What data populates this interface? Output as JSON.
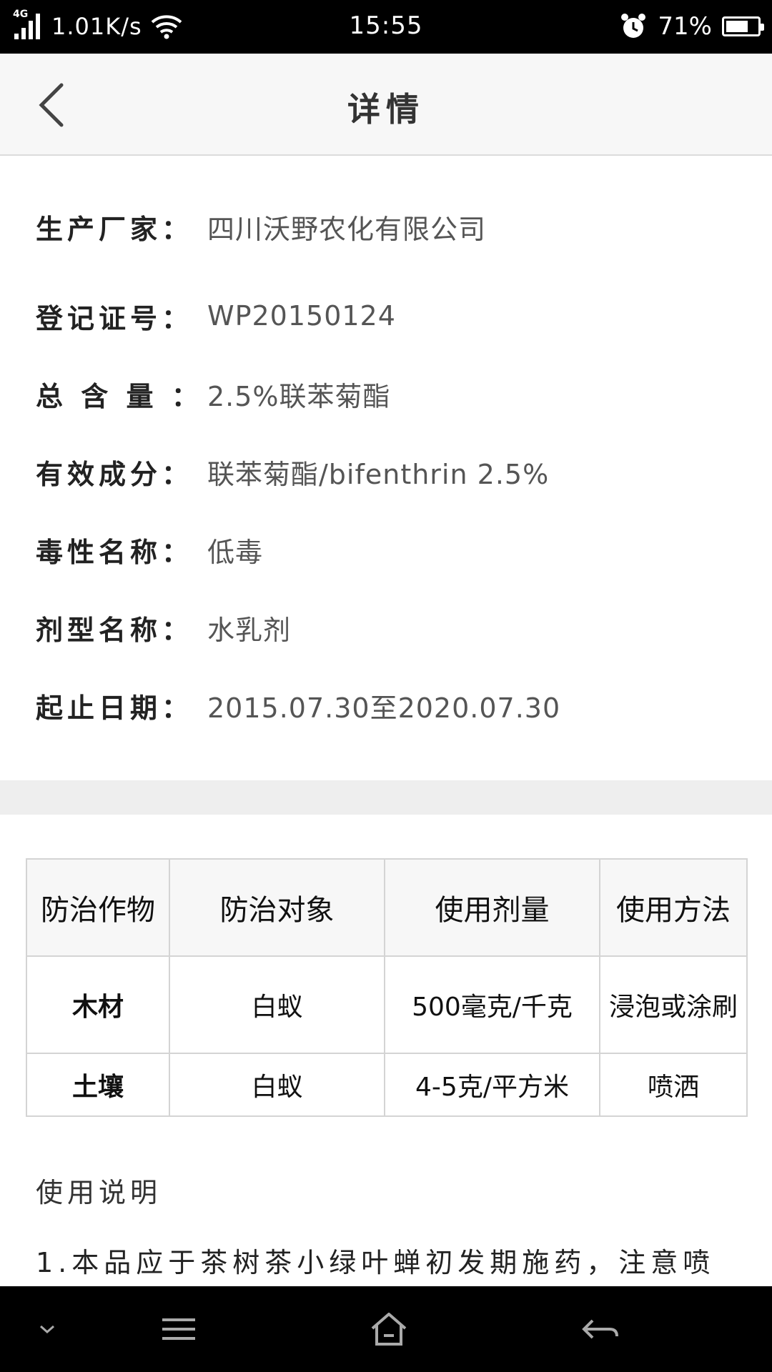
{
  "status_bar": {
    "network": "4G",
    "speed": "1.01K/s",
    "time": "15:55",
    "battery_pct": "71%",
    "battery_level": 0.71,
    "icons": [
      "signal-icon",
      "wifi-icon",
      "alarm-icon",
      "battery-icon"
    ]
  },
  "header": {
    "title": "详情",
    "back_icon": "chevron-left-icon"
  },
  "details": {
    "manufacturer": {
      "label": "生产厂家：",
      "value": "四川沃野农化有限公司"
    },
    "registration": {
      "label": "登记证号：",
      "value": "WP20150124"
    },
    "total_content": {
      "label": "总 含 量 ：",
      "value": "2.5%联苯菊酯"
    },
    "active_ingredient": {
      "label": "有效成分：",
      "value": "联苯菊酯/bifenthrin 2.5%"
    },
    "toxicity": {
      "label": "毒性名称：",
      "value": "低毒"
    },
    "formulation": {
      "label": "剂型名称：",
      "value": "水乳剂"
    },
    "validity": {
      "label": "起止日期：",
      "value": "2015.07.30至2020.07.30"
    }
  },
  "usage_table": {
    "headers": [
      "防治作物",
      "防治对象",
      "使用剂量",
      "使用方法"
    ],
    "rows": [
      [
        "木材",
        "白蚁",
        "500毫克/千克",
        "浸泡或涂刷"
      ],
      [
        "土壤",
        "白蚁",
        "4-5克/平方米",
        "喷洒"
      ]
    ]
  },
  "instructions": {
    "heading": "使用说明",
    "line1": "1.本品应于茶树茶小绿叶蝉初发期施药，注意喷"
  },
  "nav_bar": {
    "icons": [
      "chevron-down-icon",
      "menu-icon",
      "home-icon",
      "back-arrow-icon"
    ]
  }
}
